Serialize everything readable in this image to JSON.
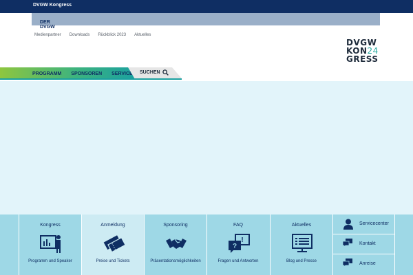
{
  "topbar": {
    "site": "DVGW Kongress"
  },
  "dvgwbar": {
    "label": "DER DVGW",
    "chevron": "›"
  },
  "metanav": [
    "Medienpartner",
    "Downloads",
    "Rückblick 2023",
    "Aktuelles"
  ],
  "logo": {
    "line1": "DVGW",
    "line2a": "KON",
    "line2b": "24",
    "line3": "GRESS"
  },
  "mainnav": {
    "items": [
      "PROGRAMM",
      "SPONSOREN",
      "SERVICE"
    ],
    "search_label": "SUCHEN",
    "search_icon": "search-icon"
  },
  "colors": {
    "navy": "#0f2e63",
    "tile_bg": "#9ed8e6",
    "tile_active": "#cdebf3",
    "hero": "#e2f4fa",
    "accent_green": "#8ec63f",
    "accent_teal": "#1aa0a0"
  },
  "tiles": [
    {
      "title": "Kongress",
      "subtitle": "Programm und Speaker",
      "icon": "presenter-icon"
    },
    {
      "title": "Anmeldung",
      "subtitle": "Preise und Tickets",
      "icon": "tickets-icon"
    },
    {
      "title": "Sponsoring",
      "subtitle": "Präsentationsmöglichkeiten",
      "icon": "handshake-icon"
    },
    {
      "title": "FAQ",
      "subtitle": "Fragen und Antworten",
      "icon": "faq-icon"
    },
    {
      "title": "Aktuelles",
      "subtitle": "Blog und Presse",
      "icon": "blog-icon"
    }
  ],
  "service": [
    {
      "label": "Servicecenter",
      "icon": "person-icon"
    },
    {
      "label": "Kontakt",
      "icon": "chat-icon"
    },
    {
      "label": "Anreise",
      "icon": "chat-icon"
    }
  ]
}
